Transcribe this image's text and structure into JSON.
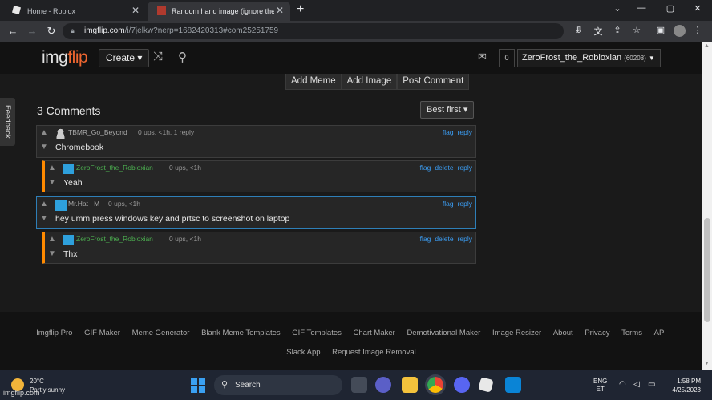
{
  "browser": {
    "tabs": [
      {
        "title": "Home - Roblox",
        "active": false
      },
      {
        "title": "Random hand image (ignore the",
        "active": true
      }
    ],
    "new_tab": "+",
    "window_controls": {
      "minimize": "⌄",
      "restore": "—",
      "maximize": "▢",
      "close": "✕"
    },
    "url_host": "imgflip.com",
    "url_path": "/i/7jelkw?nerp=1682420313#com25251759"
  },
  "site": {
    "logo_left": "img",
    "logo_right": "flip",
    "create_label": "Create ▾",
    "notif_count": "0",
    "username": "ZeroFrost_the_Robloxian",
    "user_points": "(60208)",
    "actions": [
      "Add Meme",
      "Add Image",
      "Post Comment"
    ],
    "feedback": "Feedback",
    "comments_title": "3 Comments",
    "sort_label": "Best first ▾"
  },
  "comments": [
    {
      "user": "TBMR_Go_Beyond",
      "meta": "0 ups, <1h, 1 reply",
      "text": "Chromebook",
      "links": [
        "flag",
        "reply"
      ],
      "user_color": "#aaaaaa"
    },
    {
      "user": "ZeroFrost_the_Robloxian",
      "meta": "0 ups, <1h",
      "text": "Yeah",
      "links": [
        "flag",
        "delete",
        "reply"
      ],
      "user_color": "#4caf50"
    },
    {
      "user": "Mr.Hat",
      "user_suffix": "M",
      "meta": "0 ups, <1h",
      "text": "hey umm press windows key and prtsc to screenshot on laptop",
      "links": [
        "flag",
        "reply"
      ],
      "user_color": "#aaaaaa"
    },
    {
      "user": "ZeroFrost_the_Robloxian",
      "meta": "0 ups, <1h",
      "text": "Thx",
      "links": [
        "flag",
        "delete",
        "reply"
      ],
      "user_color": "#4caf50"
    }
  ],
  "footer": {
    "row1": [
      "Imgflip Pro",
      "GIF Maker",
      "Meme Generator",
      "Blank Meme Templates",
      "GIF Templates",
      "Chart Maker",
      "Demotivational Maker",
      "Image Resizer",
      "About",
      "Privacy",
      "Terms",
      "API"
    ],
    "row2": [
      "Slack App",
      "Request Image Removal"
    ]
  },
  "taskbar": {
    "temp": "20°C",
    "condition": "Partly sunny",
    "search": "Search",
    "lang": "ENG",
    "region": "ET",
    "time": "1:58 PM",
    "date": "4/25/2023"
  },
  "watermark": "imgflip.com",
  "colors": {
    "accent_orange": "#ff8a00",
    "link_blue": "#3b9ef5",
    "brand_orange": "#f06630"
  }
}
